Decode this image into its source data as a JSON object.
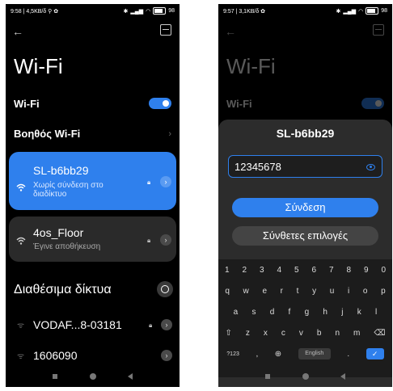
{
  "screenA": {
    "status": {
      "left": "9:58 | 4,5KB/δ ⚲ ✿",
      "battery": "98"
    },
    "title": "Wi-Fi",
    "wifi_label": "Wi-Fi",
    "wifi_assistant": "Βοηθός Wi-Fi",
    "networks": [
      {
        "name": "SL-b6bb29",
        "status_line1": "Χωρίς σύνδεση στο",
        "status_line2": "διαδίκτυο"
      },
      {
        "name": "4os_Floor",
        "status_line1": "Έγινε αποθήκευση",
        "status_line2": ""
      }
    ],
    "available_title": "Διαθέσιμα δίκτυα",
    "available": [
      {
        "name": "VODAF...8-03181"
      },
      {
        "name": "1606090"
      }
    ]
  },
  "screenB": {
    "status": {
      "left": "9:57 | 3,1KB/δ ✿",
      "battery": "98"
    },
    "title": "Wi-Fi",
    "wifi_label": "Wi-Fi",
    "dialog_title": "SL-b6bb29",
    "password_value": "12345678",
    "connect_label": "Σύνδεση",
    "advanced_label": "Σύνθετες επιλογές",
    "keyboard": {
      "numbers": [
        "1",
        "2",
        "3",
        "4",
        "5",
        "6",
        "7",
        "8",
        "9",
        "0"
      ],
      "row1": [
        "q",
        "w",
        "e",
        "r",
        "t",
        "y",
        "u",
        "i",
        "o",
        "p"
      ],
      "row2": [
        "a",
        "s",
        "d",
        "f",
        "g",
        "h",
        "j",
        "k",
        "l"
      ],
      "row3": [
        "z",
        "x",
        "c",
        "v",
        "b",
        "n",
        "m"
      ],
      "symbols": "?123",
      "comma": ",",
      "space": "English",
      "period": "."
    }
  },
  "colors": {
    "accent": "#2f80ed",
    "background": "#000000",
    "card": "#2a2a2a"
  }
}
